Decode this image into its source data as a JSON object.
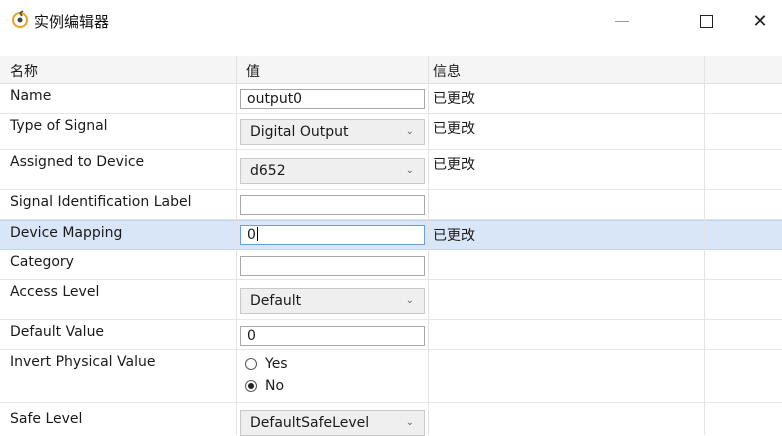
{
  "window": {
    "title": "实例编辑器",
    "icon": "refresh-app-icon",
    "close_glyph": "✕"
  },
  "columns": {
    "name": "名称",
    "value": "值",
    "info": "信息"
  },
  "rows": [
    {
      "label": "Name",
      "value": "output0",
      "info": "已更改"
    },
    {
      "label": "Type of Signal",
      "value": "Digital Output",
      "info": "已更改"
    },
    {
      "label": "Assigned to Device",
      "value": "d652",
      "info": "已更改"
    },
    {
      "label": "Signal Identification Label",
      "value": "",
      "info": ""
    },
    {
      "label": "Device Mapping",
      "value": "0",
      "info": "已更改"
    },
    {
      "label": "Category",
      "value": "",
      "info": ""
    },
    {
      "label": "Access Level",
      "value": "Default",
      "info": ""
    },
    {
      "label": "Default Value",
      "value": "0",
      "info": ""
    },
    {
      "label": "Invert Physical Value",
      "options": [
        "Yes",
        "No"
      ],
      "selected": "No",
      "info": ""
    },
    {
      "label": "Safe Level",
      "value": "DefaultSafeLevel",
      "info": ""
    }
  ],
  "chevron": "⌄",
  "colors": {
    "selected_row": "#d9e6f8",
    "header_bg": "#f5f5f5"
  }
}
